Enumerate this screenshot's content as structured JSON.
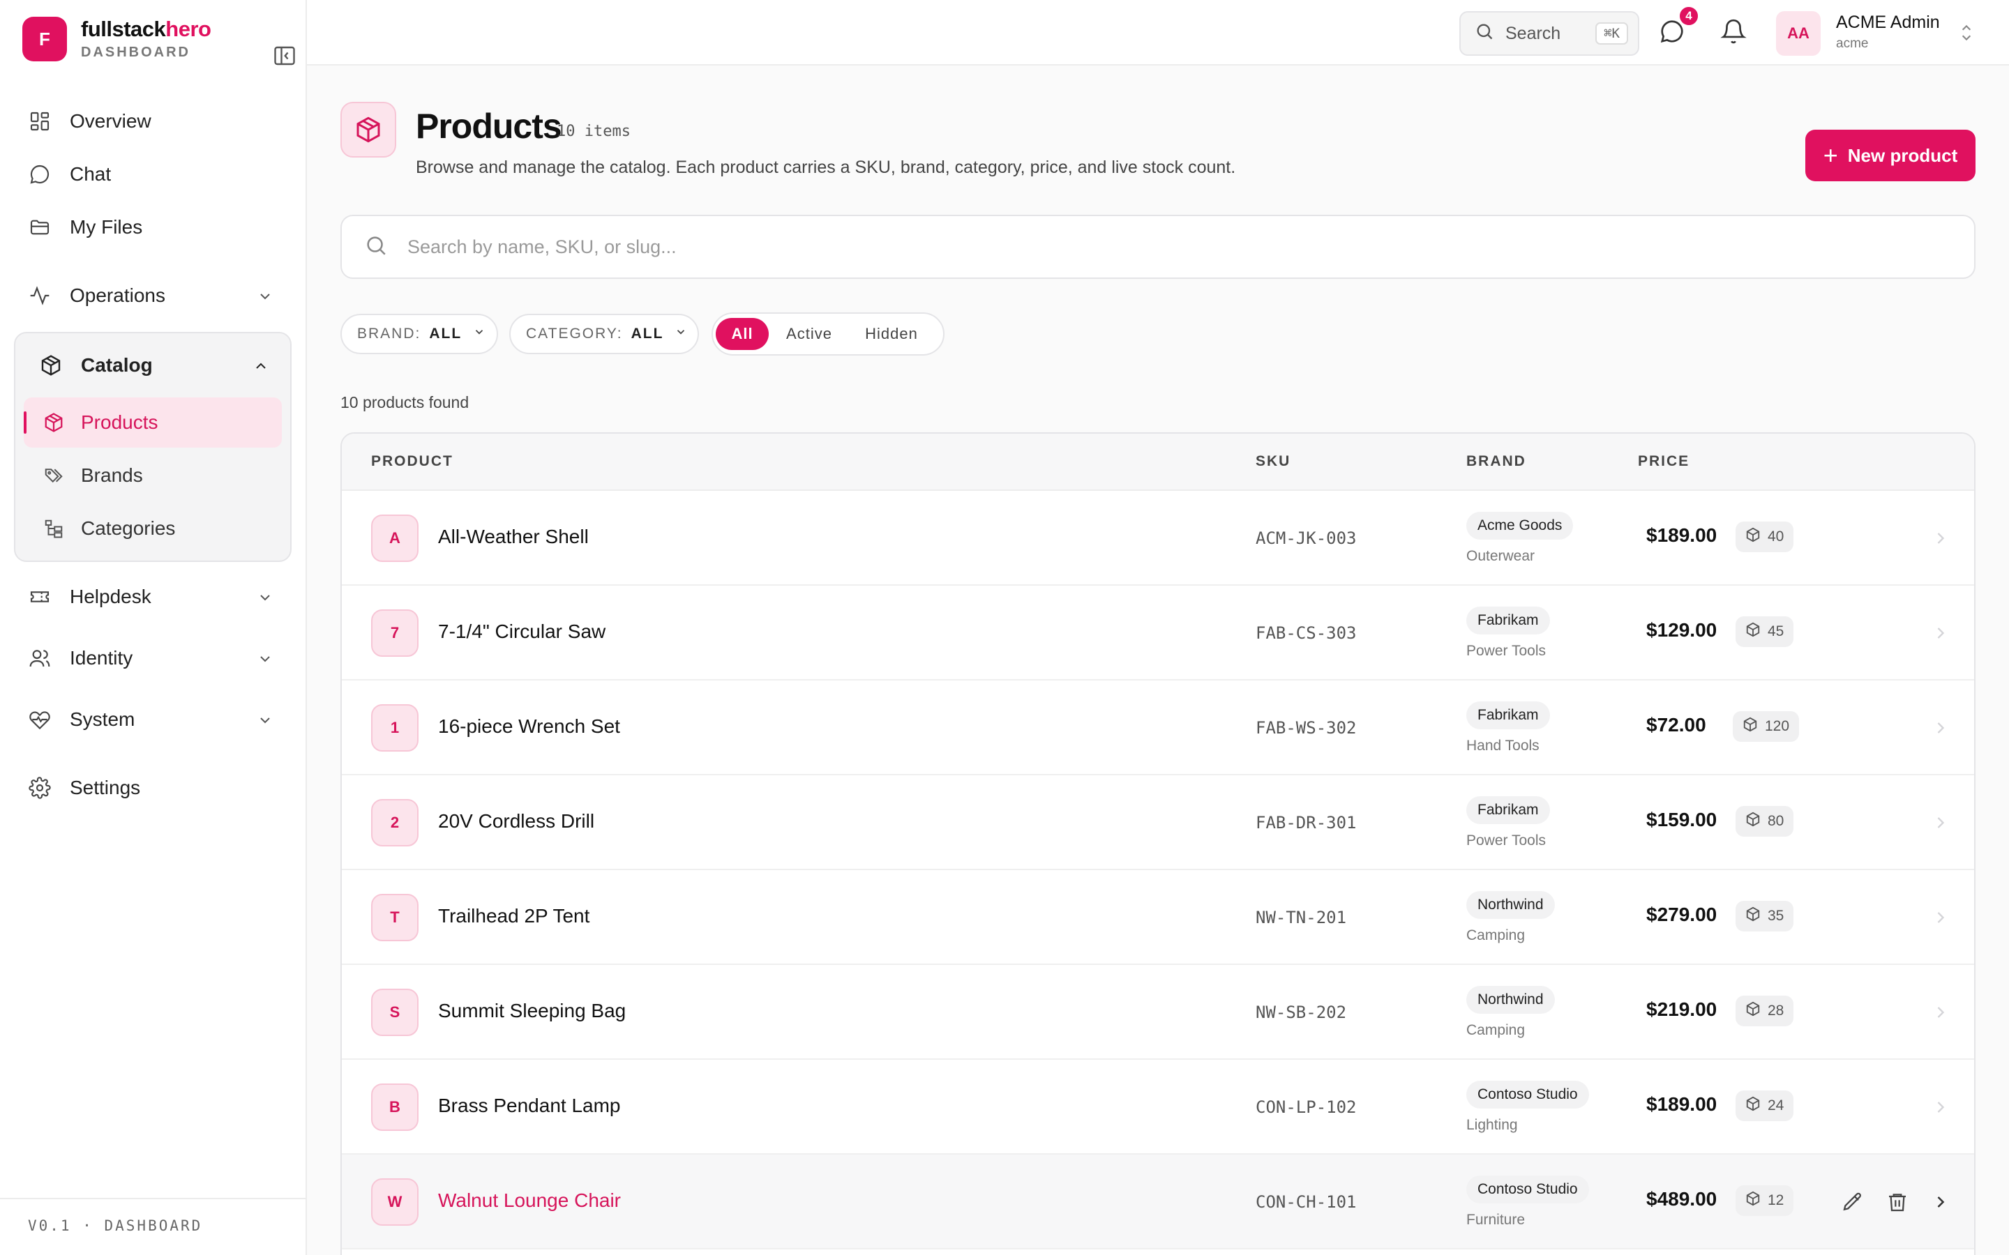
{
  "sidebar": {
    "logo_letter": "F",
    "brand_part1": "fullstack",
    "brand_part2": "hero",
    "brand_sub": "DASHBOARD",
    "items": {
      "overview": "Overview",
      "chat": "Chat",
      "files": "My Files",
      "operations": "Operations",
      "catalog": "Catalog",
      "products": "Products",
      "brands": "Brands",
      "categories": "Categories",
      "helpdesk": "Helpdesk",
      "identity": "Identity",
      "system": "System",
      "settings": "Settings"
    },
    "version": "V0.1 · DASHBOARD"
  },
  "topbar": {
    "search_label": "Search",
    "search_shortcut": "⌘K",
    "chat_badge": "4",
    "avatar_initials": "AA",
    "user_name": "ACME Admin",
    "user_tenant": "acme"
  },
  "page": {
    "title": "Products",
    "count": "10 items",
    "description": "Browse and manage the catalog. Each product carries a SKU, brand, category, price, and live stock count.",
    "new_button": "New product"
  },
  "search": {
    "placeholder": "Search by name, SKU, or slug..."
  },
  "filters": {
    "brand_key": "BRAND:",
    "brand_value": "ALL",
    "category_key": "CATEGORY:",
    "category_value": "ALL",
    "status_options": [
      "All",
      "Active",
      "Hidden"
    ],
    "status_selected": "All"
  },
  "results_text": "10 products found",
  "table": {
    "headers": {
      "product": "PRODUCT",
      "sku": "SKU",
      "brand": "BRAND",
      "price": "PRICE"
    },
    "rows": [
      {
        "initial": "A",
        "name": "All-Weather Shell",
        "sku": "ACM-JK-003",
        "brand": "Acme Goods",
        "category": "Outerwear",
        "price": "$189.00",
        "stock": "40"
      },
      {
        "initial": "7",
        "name": "7-1/4\" Circular Saw",
        "sku": "FAB-CS-303",
        "brand": "Fabrikam",
        "category": "Power Tools",
        "price": "$129.00",
        "stock": "45"
      },
      {
        "initial": "1",
        "name": "16-piece Wrench Set",
        "sku": "FAB-WS-302",
        "brand": "Fabrikam",
        "category": "Hand Tools",
        "price": "$72.00",
        "stock": "120"
      },
      {
        "initial": "2",
        "name": "20V Cordless Drill",
        "sku": "FAB-DR-301",
        "brand": "Fabrikam",
        "category": "Power Tools",
        "price": "$159.00",
        "stock": "80"
      },
      {
        "initial": "T",
        "name": "Trailhead 2P Tent",
        "sku": "NW-TN-201",
        "brand": "Northwind",
        "category": "Camping",
        "price": "$279.00",
        "stock": "35"
      },
      {
        "initial": "S",
        "name": "Summit Sleeping Bag",
        "sku": "NW-SB-202",
        "brand": "Northwind",
        "category": "Camping",
        "price": "$219.00",
        "stock": "28"
      },
      {
        "initial": "B",
        "name": "Brass Pendant Lamp",
        "sku": "CON-LP-102",
        "brand": "Contoso Studio",
        "category": "Lighting",
        "price": "$189.00",
        "stock": "24"
      },
      {
        "initial": "W",
        "name": "Walnut Lounge Chair",
        "sku": "CON-CH-101",
        "brand": "Contoso Studio",
        "category": "Furniture",
        "price": "$489.00",
        "stock": "12"
      }
    ]
  },
  "colors": {
    "accent": "#e0115f",
    "accent_soft": "#fce4ec"
  }
}
